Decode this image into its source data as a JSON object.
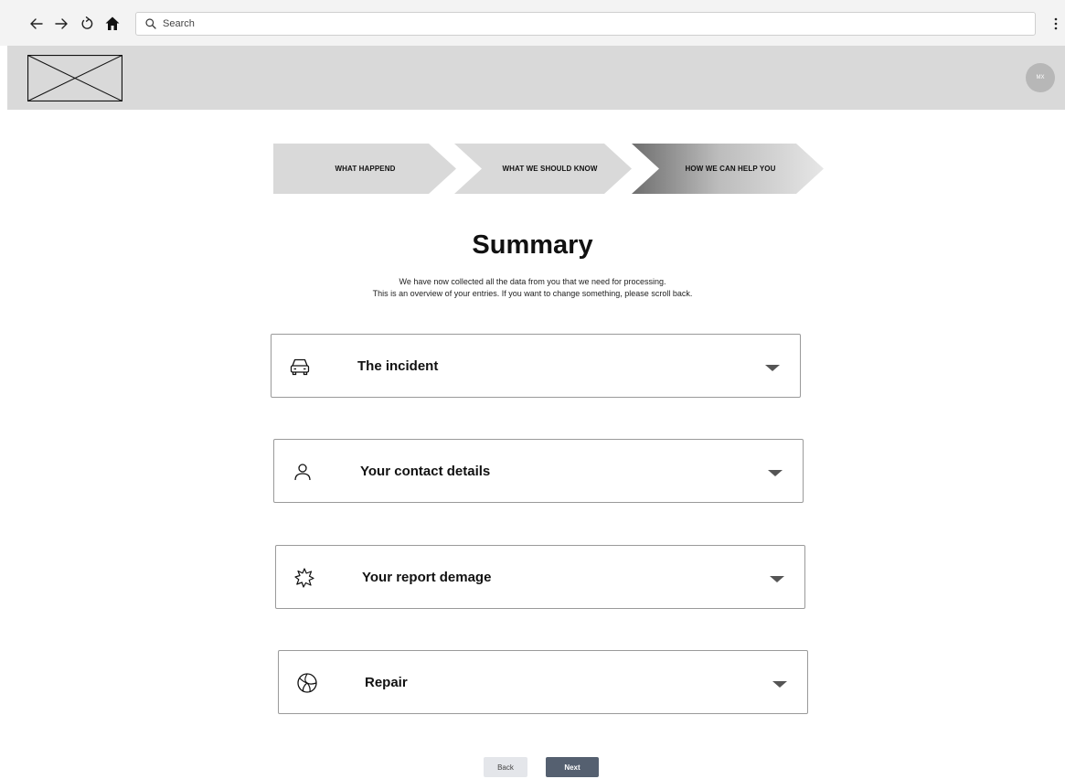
{
  "browser": {
    "search_placeholder": "Search",
    "icons": [
      "back-arrow-icon",
      "forward-arrow-icon",
      "reload-icon",
      "home-icon",
      "search-icon",
      "more-vertical-icon"
    ]
  },
  "header": {
    "avatar_initials": "MX"
  },
  "stepper": {
    "steps": [
      {
        "label": "WHAT HAPPEND",
        "state": "done"
      },
      {
        "label": "WHAT WE SHOULD KNOW",
        "state": "done"
      },
      {
        "label": "HOW WE CAN HELP YOU",
        "state": "active"
      }
    ]
  },
  "summary": {
    "title": "Summary",
    "line1": "We have now collected all the data from you that we need for processing.",
    "line2": "This is an overview of your entries. If you want to change something, please scroll back."
  },
  "sections": [
    {
      "label": "The incident",
      "icon": "car-icon"
    },
    {
      "label": "Your contact details",
      "icon": "person-icon"
    },
    {
      "label": "Your report demage",
      "icon": "damage-burst-icon"
    },
    {
      "label": "Repair",
      "icon": "aperture-icon"
    }
  ],
  "actions": {
    "back_label": "Back",
    "next_label": "Next"
  },
  "colors": {
    "step_done": "#d9d9d9",
    "step_active_start": "#6e6e6e",
    "step_active_end": "#e6e6e6",
    "next_button": "#556070"
  }
}
